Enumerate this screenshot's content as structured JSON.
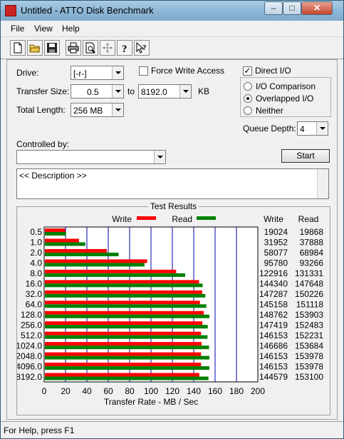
{
  "window": {
    "title": "Untitled - ATTO Disk Benchmark",
    "min": "–",
    "max": "□",
    "close": "✕"
  },
  "menu": [
    "File",
    "View",
    "Help"
  ],
  "toolbar_icons": [
    "new-icon",
    "open-icon",
    "save-icon",
    "print-icon",
    "print-preview-icon",
    "move-icon",
    "help-icon",
    "context-help-icon"
  ],
  "form": {
    "drive_label": "Drive:",
    "drive_value": "[-r-]",
    "force_write_label": "Force Write Access",
    "force_write_checked": false,
    "direct_io_label": "Direct I/O",
    "direct_io_checked": true,
    "transfer_size_label": "Transfer Size:",
    "transfer_from": "0.5",
    "to_label": "to",
    "transfer_to": "8192.0",
    "kb_label": "KB",
    "total_length_label": "Total Length:",
    "total_length_value": "256 MB",
    "io_options": [
      {
        "label": "I/O Comparison",
        "selected": false
      },
      {
        "label": "Overlapped I/O",
        "selected": true
      },
      {
        "label": "Neither",
        "selected": false
      }
    ],
    "queue_depth_label": "Queue Depth:",
    "queue_depth_value": "4",
    "controlled_by_label": "Controlled by:",
    "controlled_by_value": "",
    "start_label": "Start",
    "description_text": "<< Description >>"
  },
  "results": {
    "group_title": "Test Results",
    "legend_write": "Write",
    "legend_read": "Read",
    "col_write": "Write",
    "col_read": "Read"
  },
  "chart_data": {
    "type": "bar",
    "orientation": "horizontal",
    "categories": [
      "0.5",
      "1.0",
      "2.0",
      "4.0",
      "8.0",
      "16.0",
      "32.0",
      "64.0",
      "128.0",
      "256.0",
      "512.0",
      "1024.0",
      "2048.0",
      "4096.0",
      "8192.0"
    ],
    "series": [
      {
        "name": "Write",
        "color": "#ff0000",
        "values": [
          19024,
          31952,
          58077,
          95780,
          122916,
          144340,
          147287,
          145158,
          148762,
          147419,
          146153,
          146686,
          146153,
          146153,
          144579
        ],
        "display": [
          "19024",
          "31952",
          "58077",
          "95780",
          "122916",
          "144340",
          "147287",
          "145158",
          "148762",
          "147419",
          "146153",
          "146686",
          "146153",
          "146153",
          "144579"
        ]
      },
      {
        "name": "Read",
        "color": "#008000",
        "values": [
          19868,
          37888,
          68984,
          93266,
          131331,
          147648,
          150226,
          151118,
          153903,
          152483,
          152231,
          153684,
          153978,
          153978,
          153100
        ],
        "display": [
          "19868",
          "37888",
          "68984",
          "93266",
          "131331",
          "147648",
          "150226",
          "151118",
          "153903",
          "152483",
          "152231",
          "153684",
          "153978",
          "153978",
          "153100"
        ]
      }
    ],
    "value_unit_scale": 1000,
    "xlabel": "Transfer Rate - MB / Sec",
    "xticks": [
      "0",
      "20",
      "40",
      "60",
      "80",
      "100",
      "120",
      "140",
      "160",
      "180",
      "200"
    ],
    "xlim": [
      0,
      200
    ],
    "grid": true,
    "gridline_color": "#0000aa"
  },
  "status": {
    "text": "For Help, press F1"
  }
}
